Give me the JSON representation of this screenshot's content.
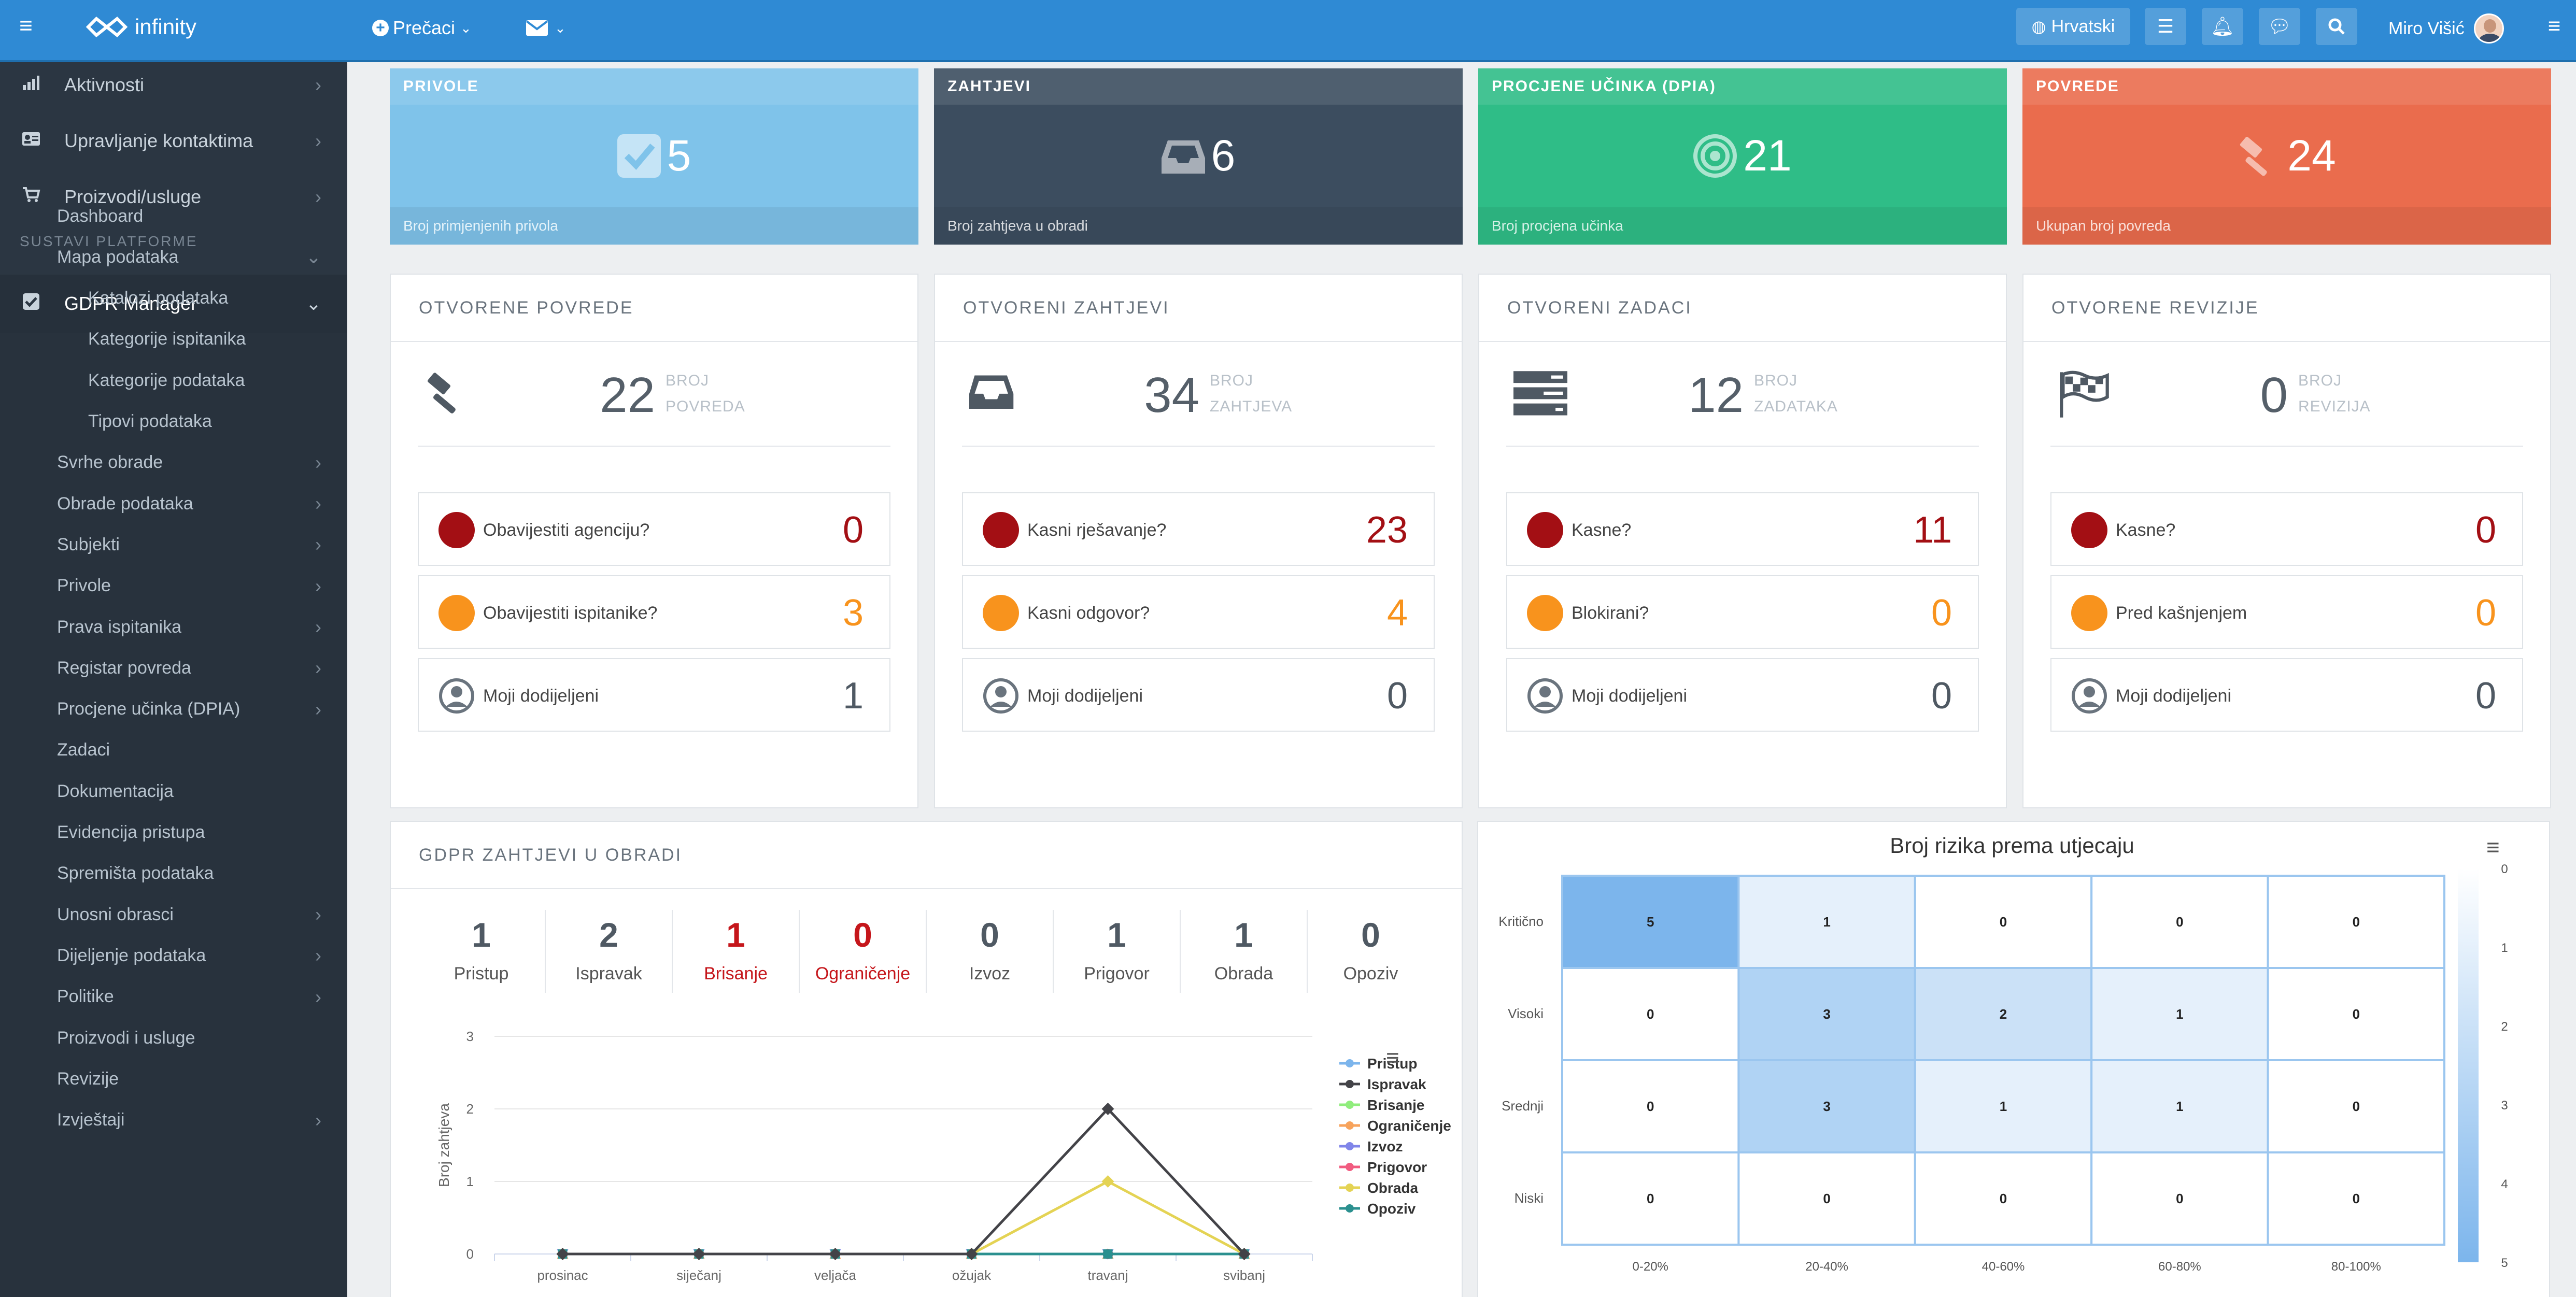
{
  "topbar": {
    "logo": "infinity",
    "shortcuts": "Prečaci",
    "language": "Hrvatski",
    "user": "Miro Višić"
  },
  "sidebar": {
    "top_items": [
      {
        "label": "Aktivnosti",
        "icon": "bar-chart-icon"
      },
      {
        "label": "Upravljanje kontaktima",
        "icon": "contact-card-icon"
      },
      {
        "label": "Proizvodi/usluge",
        "icon": "cart-icon"
      }
    ],
    "section_title": "SUSTAVI PLATFORME",
    "active_item": "GDPR Manager",
    "sub_items": [
      {
        "label": "Dashboard",
        "level": 1,
        "chevron": ""
      },
      {
        "label": "Mapa podataka",
        "level": 1,
        "chevron": "down"
      },
      {
        "label": "Katalozi podataka",
        "level": 2,
        "chevron": ""
      },
      {
        "label": "Kategorije ispitanika",
        "level": 2,
        "chevron": ""
      },
      {
        "label": "Kategorije podataka",
        "level": 2,
        "chevron": ""
      },
      {
        "label": "Tipovi podataka",
        "level": 2,
        "chevron": ""
      },
      {
        "label": "Svrhe obrade",
        "level": 1,
        "chevron": "right"
      },
      {
        "label": "Obrade podataka",
        "level": 1,
        "chevron": "right"
      },
      {
        "label": "Subjekti",
        "level": 1,
        "chevron": "right"
      },
      {
        "label": "Privole",
        "level": 1,
        "chevron": "right"
      },
      {
        "label": "Prava ispitanika",
        "level": 1,
        "chevron": "right"
      },
      {
        "label": "Registar povreda",
        "level": 1,
        "chevron": "right"
      },
      {
        "label": "Procjene učinka (DPIA)",
        "level": 1,
        "chevron": "right"
      },
      {
        "label": "Zadaci",
        "level": 1,
        "chevron": ""
      },
      {
        "label": "Dokumentacija",
        "level": 1,
        "chevron": ""
      },
      {
        "label": "Evidencija pristupa",
        "level": 1,
        "chevron": ""
      },
      {
        "label": "Spremišta podataka",
        "level": 1,
        "chevron": ""
      },
      {
        "label": "Unosni obrasci",
        "level": 1,
        "chevron": "right"
      },
      {
        "label": "Dijeljenje podataka",
        "level": 1,
        "chevron": "right"
      },
      {
        "label": "Politike",
        "level": 1,
        "chevron": "right"
      },
      {
        "label": "Proizvodi i usluge",
        "level": 1,
        "chevron": ""
      },
      {
        "label": "Revizije",
        "level": 1,
        "chevron": ""
      },
      {
        "label": "Izvještaji",
        "level": 1,
        "chevron": "right"
      }
    ]
  },
  "stats": [
    {
      "title": "PRIVOLE",
      "value": "5",
      "footer": "Broj primjenjenih privola",
      "color": "#7fc3ea",
      "icon": "checkbox-icon"
    },
    {
      "title": "ZAHTJEVI",
      "value": "6",
      "footer": "Broj zahtjeva u obradi",
      "color": "#3c4d5f",
      "icon": "inbox-icon"
    },
    {
      "title": "PROCJENE UČINKA (DPIA)",
      "value": "21",
      "footer": "Broj procjena učinka",
      "color": "#2fbd87",
      "icon": "target-icon"
    },
    {
      "title": "POVREDE",
      "value": "24",
      "footer": "Ukupan broj povreda",
      "color": "#ea6c4d",
      "icon": "gavel-icon"
    }
  ],
  "panels": [
    {
      "title": "OTVORENE POVREDE",
      "icon": "gavel-icon",
      "count": "22",
      "count_label": [
        "BROJ",
        "POVREDA"
      ],
      "rows": [
        {
          "label": "Obavijestiti agenciju?",
          "value": "0",
          "dot": "#a30f14",
          "value_color": "#a30f14"
        },
        {
          "label": "Obavijestiti ispitanike?",
          "value": "3",
          "dot": "#f8931d",
          "value_color": "#f8931d"
        },
        {
          "label": "Moji dodijeljeni",
          "value": "1",
          "dot": "",
          "value_color": "#4f5963"
        }
      ]
    },
    {
      "title": "OTVORENI ZAHTJEVI",
      "icon": "inbox-icon",
      "count": "34",
      "count_label": [
        "BROJ",
        "ZAHTJEVA"
      ],
      "rows": [
        {
          "label": "Kasni rješavanje?",
          "value": "23",
          "dot": "#a30f14",
          "value_color": "#a30f14"
        },
        {
          "label": "Kasni odgovor?",
          "value": "4",
          "dot": "#f8931d",
          "value_color": "#f8931d"
        },
        {
          "label": "Moji dodijeljeni",
          "value": "0",
          "dot": "",
          "value_color": "#4f5963"
        }
      ]
    },
    {
      "title": "OTVORENI ZADACI",
      "icon": "tasks-icon",
      "count": "12",
      "count_label": [
        "BROJ",
        "ZADATAKA"
      ],
      "rows": [
        {
          "label": "Kasne?",
          "value": "11",
          "dot": "#a30f14",
          "value_color": "#a30f14"
        },
        {
          "label": "Blokirani?",
          "value": "0",
          "dot": "#f8931d",
          "value_color": "#f8931d"
        },
        {
          "label": "Moji dodijeljeni",
          "value": "0",
          "dot": "",
          "value_color": "#4f5963"
        }
      ]
    },
    {
      "title": "OTVORENE REVIZIJE",
      "icon": "flag-icon",
      "count": "0",
      "count_label": [
        "BROJ",
        "REVIZIJA"
      ],
      "rows": [
        {
          "label": "Kasne?",
          "value": "0",
          "dot": "#a30f14",
          "value_color": "#a30f14"
        },
        {
          "label": "Pred kašnjenjem",
          "value": "0",
          "dot": "#f8931d",
          "value_color": "#f8931d"
        },
        {
          "label": "Moji dodijeljeni",
          "value": "0",
          "dot": "",
          "value_color": "#4f5963"
        }
      ]
    }
  ],
  "requests": {
    "title": "GDPR ZAHTJEVI U OBRADI",
    "counts": [
      {
        "label": "Pristup",
        "value": "1",
        "highlight": false
      },
      {
        "label": "Ispravak",
        "value": "2",
        "highlight": false
      },
      {
        "label": "Brisanje",
        "value": "1",
        "highlight": true
      },
      {
        "label": "Ograničenje",
        "value": "0",
        "highlight": true
      },
      {
        "label": "Izvoz",
        "value": "0",
        "highlight": false
      },
      {
        "label": "Prigovor",
        "value": "1",
        "highlight": false
      },
      {
        "label": "Obrada",
        "value": "1",
        "highlight": false
      },
      {
        "label": "Opoziv",
        "value": "0",
        "highlight": false
      }
    ]
  },
  "chart_data": [
    {
      "type": "line",
      "title": "",
      "xlabel": "",
      "ylabel": "Broj zahtjeva",
      "categories": [
        "prosinac",
        "siječanj",
        "veljača",
        "ožujak",
        "travanj",
        "svibanj"
      ],
      "ylim": [
        0,
        3
      ],
      "yticks": [
        "0",
        "1",
        "2",
        "3"
      ],
      "grid": true,
      "legend_position": "right",
      "series": [
        {
          "name": "Pristup",
          "color": "#7cb5ec",
          "marker": "circle",
          "values": [
            0,
            0,
            0,
            0,
            0,
            0
          ]
        },
        {
          "name": "Ispravak",
          "color": "#434348",
          "marker": "diamond",
          "values": [
            0,
            0,
            0,
            0,
            2,
            0
          ]
        },
        {
          "name": "Brisanje",
          "color": "#90ed7d",
          "marker": "square",
          "values": [
            0,
            0,
            0,
            0,
            0,
            0
          ]
        },
        {
          "name": "Ograničenje",
          "color": "#f7a35c",
          "marker": "triangle",
          "values": [
            0,
            0,
            0,
            0,
            0,
            0
          ]
        },
        {
          "name": "Izvoz",
          "color": "#8085e9",
          "marker": "triangle-down",
          "values": [
            0,
            0,
            0,
            0,
            0,
            0
          ]
        },
        {
          "name": "Prigovor",
          "color": "#f15c80",
          "marker": "circle",
          "values": [
            0,
            0,
            0,
            0,
            0,
            0
          ]
        },
        {
          "name": "Obrada",
          "color": "#e4d354",
          "marker": "diamond",
          "values": [
            0,
            0,
            0,
            0,
            1,
            0
          ]
        },
        {
          "name": "Opoziv",
          "color": "#2b908f",
          "marker": "square",
          "values": [
            0,
            0,
            0,
            0,
            0,
            0
          ]
        }
      ]
    },
    {
      "type": "heatmap",
      "title": "Broj rizika prema utjecaju",
      "x_categories": [
        "0-20%",
        "20-40%",
        "40-60%",
        "60-80%",
        "80-100%"
      ],
      "y_categories": [
        "Kritično",
        "Visoki",
        "Srednji",
        "Niski"
      ],
      "values": [
        [
          5,
          1,
          0,
          0,
          0
        ],
        [
          0,
          3,
          2,
          1,
          0
        ],
        [
          0,
          3,
          1,
          1,
          0
        ],
        [
          0,
          0,
          0,
          0,
          0
        ]
      ],
      "color_scale": [
        "#ffffff",
        "#7cb5ec"
      ],
      "color_axis": [
        "0",
        "1",
        "2",
        "3",
        "4",
        "5"
      ],
      "legend_position": "right"
    }
  ]
}
